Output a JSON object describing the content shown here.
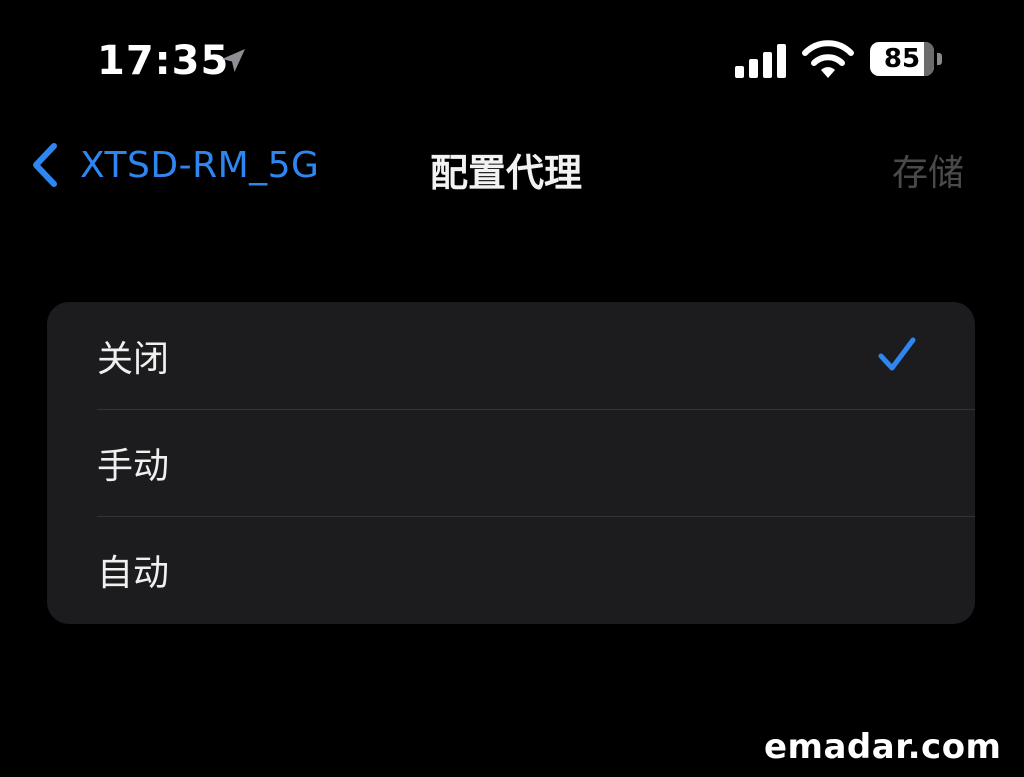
{
  "status_bar": {
    "time": "17:35",
    "battery_level": "85",
    "battery_fraction": 0.85,
    "icons": [
      "location-arrow-icon",
      "cellular-signal-icon",
      "wifi-icon",
      "battery-icon"
    ]
  },
  "nav_bar": {
    "back_label": "XTSD-RM_5G",
    "title": "配置代理",
    "save_label": "存储"
  },
  "options": [
    {
      "label": "关闭",
      "selected": true
    },
    {
      "label": "手动",
      "selected": false
    },
    {
      "label": "自动",
      "selected": false
    }
  ],
  "colors": {
    "background": "#000000",
    "accent": "#2f86f0",
    "list_background": "#1c1c1e",
    "disabled_text": "#4a4a4a"
  },
  "watermark": "emadar.com"
}
